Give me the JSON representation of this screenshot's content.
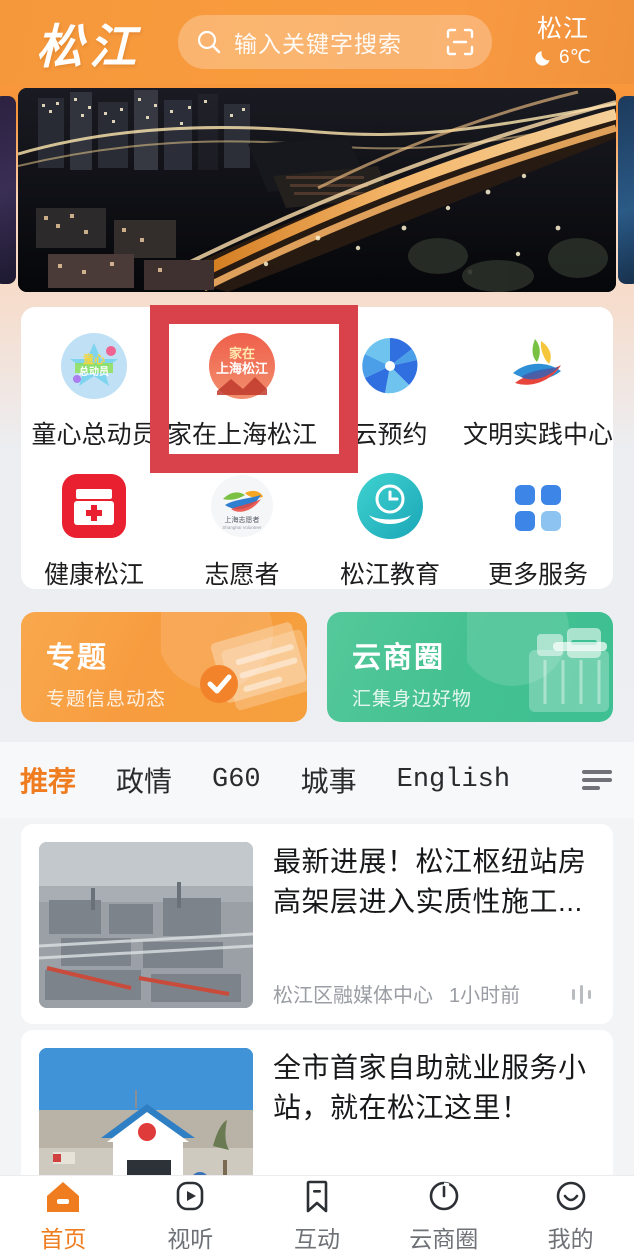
{
  "header": {
    "logo_text": "松江",
    "search": {
      "icon": "search-icon",
      "placeholder": "输入关键字搜索",
      "value": "",
      "scan_icon": "scan-icon"
    },
    "weather": {
      "city": "松江",
      "icon": "moon-icon",
      "temperature": "6℃"
    },
    "bg_color": "#f7953b"
  },
  "banner": {
    "name": "night-cityscape-carousel",
    "description": "夜景航拍高架路"
  },
  "services": {
    "items": [
      {
        "label": "童心总动员",
        "icon": "tongxin-app-icon"
      },
      {
        "label": "家在上海松江",
        "icon": "jiazai-shanghai-songjiang-icon"
      },
      {
        "label": "云预约",
        "icon": "yunyuyue-icon"
      },
      {
        "label": "文明实践中心",
        "icon": "wenming-shijian-icon"
      },
      {
        "label": "健康松江",
        "icon": "jiankang-songjiang-icon"
      },
      {
        "label": "志愿者",
        "icon": "zhiyuanzhe-icon"
      },
      {
        "label": "松江教育",
        "icon": "songjiang-jiaoyu-icon"
      },
      {
        "label": "更多服务",
        "icon": "more-grid-icon"
      }
    ],
    "highlight_index": 1,
    "highlight_color": "#d9414b"
  },
  "promos": [
    {
      "title": "专题",
      "subtitle": "专题信息动态",
      "color": "#f79c3f",
      "art": "documents-check-icon"
    },
    {
      "title": "云商圈",
      "subtitle": "汇集身边好物",
      "color": "#45c191",
      "art": "shopping-basket-icon"
    }
  ],
  "feed": {
    "tabs": [
      {
        "label": "推荐",
        "active": true
      },
      {
        "label": "政情",
        "active": false
      },
      {
        "label": "G60",
        "active": false
      },
      {
        "label": "城事",
        "active": false
      },
      {
        "label": "English",
        "active": false
      }
    ],
    "menu_icon": "tab-list-icon",
    "active_color": "#ef7c1f",
    "articles": [
      {
        "title": "最新进展！松江枢纽站房高架层进入实质性施工...",
        "source": "松江区融媒体中心",
        "time": "1小时前",
        "audio_icon": "audio-wave-icon",
        "thumb": "construction-site-aerial"
      },
      {
        "title": "全市首家自助就业服务小站，就在松江这里！",
        "source": "",
        "time": "",
        "audio_icon": "",
        "thumb": "service-station-building"
      }
    ]
  },
  "bottom_nav": {
    "items": [
      {
        "label": "首页",
        "icon": "home-icon",
        "active": true
      },
      {
        "label": "视听",
        "icon": "play-icon",
        "active": false
      },
      {
        "label": "互动",
        "icon": "bookmark-icon",
        "active": false
      },
      {
        "label": "云商圈",
        "icon": "circle-refresh-icon",
        "active": false
      },
      {
        "label": "我的",
        "icon": "smiley-face-icon",
        "active": false
      }
    ],
    "active_color": "#ef7c1f"
  }
}
